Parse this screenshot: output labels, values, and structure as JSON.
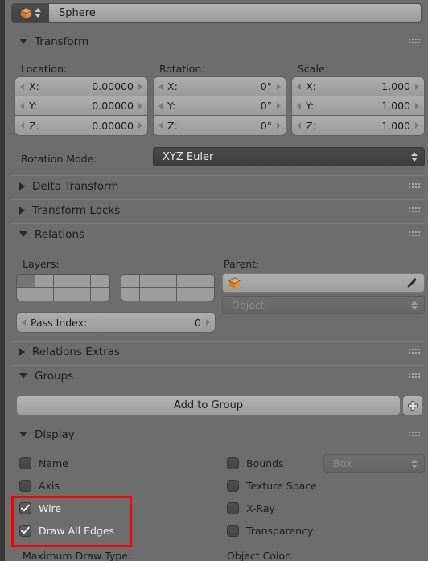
{
  "header": {
    "object_icon": "cube-icon",
    "selector_icon": "up-down-arrows-icon",
    "object_name": "Sphere"
  },
  "panels": {
    "transform": {
      "label": "Transform",
      "expanded": true
    },
    "delta_transform": {
      "label": "Delta Transform",
      "expanded": false
    },
    "transform_locks": {
      "label": "Transform Locks",
      "expanded": false
    },
    "relations": {
      "label": "Relations",
      "expanded": true
    },
    "relations_extras": {
      "label": "Relations Extras",
      "expanded": false
    },
    "groups": {
      "label": "Groups",
      "expanded": true
    },
    "display": {
      "label": "Display",
      "expanded": true
    }
  },
  "transform": {
    "location_label": "Location:",
    "rotation_label": "Rotation:",
    "scale_label": "Scale:",
    "location": [
      {
        "axis": "X:",
        "value": "0.00000"
      },
      {
        "axis": "Y:",
        "value": "0.00000"
      },
      {
        "axis": "Z:",
        "value": "0.00000"
      }
    ],
    "rotation": [
      {
        "axis": "X:",
        "value": "0°"
      },
      {
        "axis": "Y:",
        "value": "0°"
      },
      {
        "axis": "Z:",
        "value": "0°"
      }
    ],
    "scale": [
      {
        "axis": "X:",
        "value": "1.000"
      },
      {
        "axis": "Y:",
        "value": "1.000"
      },
      {
        "axis": "Z:",
        "value": "1.000"
      }
    ],
    "rotation_mode_label": "Rotation Mode:",
    "rotation_mode_value": "XYZ Euler"
  },
  "relations": {
    "layers_label": "Layers:",
    "layers_block_a": [
      true,
      false,
      false,
      false,
      false,
      false,
      false,
      false,
      false,
      false
    ],
    "layers_block_b": [
      false,
      false,
      false,
      false,
      false,
      false,
      false,
      false,
      false,
      false
    ],
    "pass_index_label": "Pass Index:",
    "pass_index_value": "0",
    "parent_label": "Parent:",
    "parent_value": "",
    "parent_icon": "cube-icon",
    "eyedropper_icon": "eyedropper-icon",
    "parent_type_value": "Object"
  },
  "groups": {
    "add_to_group_label": "Add to Group",
    "add_icon": "plus-icon"
  },
  "display": {
    "left_column": [
      {
        "label": "Name",
        "checked": false
      },
      {
        "label": "Axis",
        "checked": false
      },
      {
        "label": "Wire",
        "checked": true
      },
      {
        "label": "Draw All Edges",
        "checked": true
      }
    ],
    "right_column": [
      {
        "label": "Bounds",
        "checked": false
      },
      {
        "label": "Texture Space",
        "checked": false
      },
      {
        "label": "X-Ray",
        "checked": false
      },
      {
        "label": "Transparency",
        "checked": false
      }
    ],
    "bounds_type_value": "Box",
    "maximum_draw_type_label": "Maximum Draw Type:",
    "object_color_label": "Object Color:"
  },
  "annotation": {
    "highlight_color": "#ff0000",
    "highlights": [
      "Wire",
      "Draw All Edges"
    ]
  }
}
